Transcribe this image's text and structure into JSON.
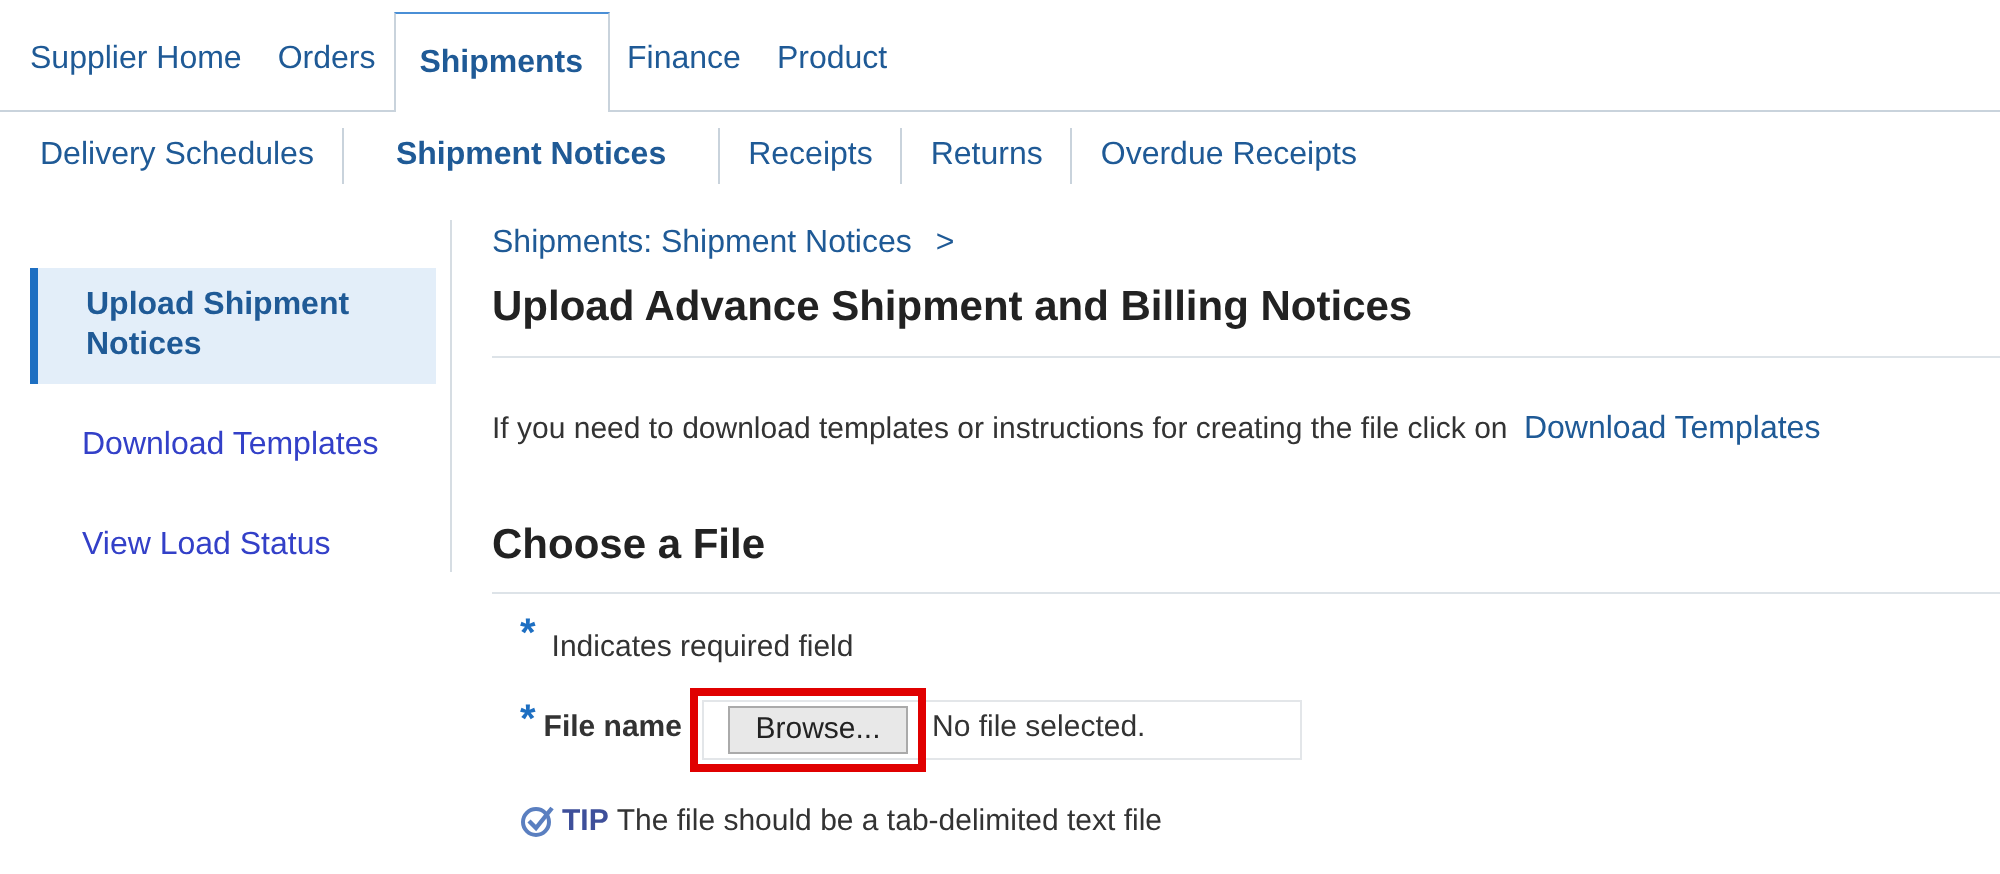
{
  "tabs": [
    {
      "label": "Supplier Home",
      "selected": false
    },
    {
      "label": "Orders",
      "selected": false
    },
    {
      "label": "Shipments",
      "selected": true
    },
    {
      "label": "Finance",
      "selected": false
    },
    {
      "label": "Product",
      "selected": false
    }
  ],
  "subtabs": [
    {
      "label": "Delivery Schedules",
      "selected": false
    },
    {
      "label": "Shipment Notices",
      "selected": true
    },
    {
      "label": "Receipts",
      "selected": false
    },
    {
      "label": "Returns",
      "selected": false
    },
    {
      "label": "Overdue Receipts",
      "selected": false
    }
  ],
  "sidebar": {
    "items": [
      {
        "label": "Upload Shipment Notices",
        "selected": true
      },
      {
        "label": "Download Templates",
        "selected": false
      },
      {
        "label": "View Load Status",
        "selected": false
      }
    ]
  },
  "breadcrumb": {
    "link": "Shipments: Shipment Notices",
    "separator": ">"
  },
  "title": "Upload Advance Shipment and Billing Notices",
  "instructions": {
    "text": "If you need to download templates or instructions for creating the file click on",
    "link": "Download Templates"
  },
  "section_title": "Choose a File",
  "required_note": {
    "mark": "*",
    "text": "Indicates required field"
  },
  "file_field": {
    "mark": "*",
    "label": "File name",
    "button": "Browse...",
    "value": "No file selected.",
    "highlighted": true
  },
  "tip": {
    "label": "TIP",
    "text": "The file should be a tab-delimited text file"
  }
}
